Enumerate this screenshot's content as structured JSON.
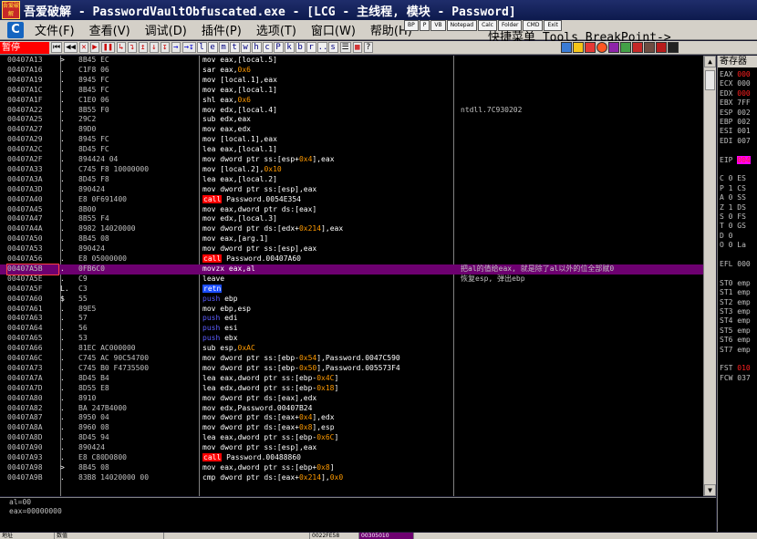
{
  "window": {
    "logo_text": "吾爱破解",
    "title": "吾爱破解 - PasswordVaultObfuscated.exe - [LCG -  主线程, 模块 - Password]"
  },
  "menu": {
    "items": [
      "文件(F)",
      "查看(V)",
      "调试(D)",
      "插件(P)",
      "选项(T)",
      "窗口(W)",
      "帮助(H)"
    ],
    "quick_tools": [
      "BP",
      "P",
      "VB",
      "Notepad",
      "Calc",
      "Folder",
      "CMD",
      "Exit"
    ],
    "extra": "快捷菜单  Tools  BreakPoint->"
  },
  "toolbar": {
    "pause_label": "暂停",
    "nav_buttons": [
      "⏮",
      "◀◀",
      "✕",
      "▶",
      "❚❚",
      "↳",
      "↴",
      "↥",
      "↓",
      "↧",
      "→",
      "→↧"
    ],
    "letter_buttons": [
      "l",
      "e",
      "m",
      "t",
      "w",
      "h",
      "c",
      "P",
      "k",
      "b",
      "r",
      "...",
      "s"
    ],
    "misc_buttons": [
      "☰",
      "▦",
      "?"
    ]
  },
  "disasm": {
    "rows": [
      {
        "addr": "00407A13",
        "mark": ">",
        "hex": "8B45 EC",
        "asm": "mov eax,[local.5]",
        "comment": ""
      },
      {
        "addr": "00407A16",
        "mark": ".",
        "hex": "C1F8 06",
        "asm": "sar eax,0x6",
        "comment": ""
      },
      {
        "addr": "00407A19",
        "mark": ".",
        "hex": "8945 FC",
        "asm": "mov [local.1],eax",
        "comment": ""
      },
      {
        "addr": "00407A1C",
        "mark": ".",
        "hex": "8B45 FC",
        "asm": "mov eax,[local.1]",
        "comment": ""
      },
      {
        "addr": "00407A1F",
        "mark": ".",
        "hex": "C1E0 06",
        "asm": "shl eax,0x6",
        "comment": ""
      },
      {
        "addr": "00407A22",
        "mark": ".",
        "hex": "8B55 F0",
        "asm": "mov edx,[local.4]",
        "comment": "ntdll.7C930202"
      },
      {
        "addr": "00407A25",
        "mark": ".",
        "hex": "29C2",
        "asm": "sub edx,eax",
        "comment": ""
      },
      {
        "addr": "00407A27",
        "mark": ".",
        "hex": "89D0",
        "asm": "mov eax,edx",
        "comment": ""
      },
      {
        "addr": "00407A29",
        "mark": ".",
        "hex": "8945 FC",
        "asm": "mov [local.1],eax",
        "comment": ""
      },
      {
        "addr": "00407A2C",
        "mark": ".",
        "hex": "8D45 FC",
        "asm": "lea eax,[local.1]",
        "comment": ""
      },
      {
        "addr": "00407A2F",
        "mark": ".",
        "hex": "894424 04",
        "asm": "mov dword ptr ss:[esp+0x4],eax",
        "comment": ""
      },
      {
        "addr": "00407A33",
        "mark": ".",
        "hex": "C745 F8 10000000",
        "asm": "mov [local.2],0x10",
        "comment": ""
      },
      {
        "addr": "00407A3A",
        "mark": ".",
        "hex": "8D45 F8",
        "asm": "lea eax,[local.2]",
        "comment": ""
      },
      {
        "addr": "00407A3D",
        "mark": ".",
        "hex": "890424",
        "asm": "mov dword ptr ss:[esp],eax",
        "comment": ""
      },
      {
        "addr": "00407A40",
        "mark": ".",
        "hex": "E8 0F691400",
        "asm": "call Password.0054E354",
        "comment": ""
      },
      {
        "addr": "00407A45",
        "mark": ".",
        "hex": "8B00",
        "asm": "mov eax,dword ptr ds:[eax]",
        "comment": ""
      },
      {
        "addr": "00407A47",
        "mark": ".",
        "hex": "8B55 F4",
        "asm": "mov edx,[local.3]",
        "comment": ""
      },
      {
        "addr": "00407A4A",
        "mark": ".",
        "hex": "8982 14020000",
        "asm": "mov dword ptr ds:[edx+0x214],eax",
        "comment": ""
      },
      {
        "addr": "00407A50",
        "mark": ".",
        "hex": "8B45 08",
        "asm": "mov eax,[arg.1]",
        "comment": ""
      },
      {
        "addr": "00407A53",
        "mark": ".",
        "hex": "890424",
        "asm": "mov dword ptr ss:[esp],eax",
        "comment": ""
      },
      {
        "addr": "00407A56",
        "mark": ".",
        "hex": "E8 05000000",
        "asm": "call Password.00407A60",
        "comment": ""
      },
      {
        "addr": "00407A5B",
        "mark": ".",
        "hex": "0FB6C0",
        "asm": "movzx eax,al",
        "comment": "把al的值给eax, 就是除了al以外的位全部赋0"
      },
      {
        "addr": "00407A5E",
        "mark": ".",
        "hex": "C9",
        "asm": "leave",
        "comment": "恢复esp, 弹出ebp"
      },
      {
        "addr": "00407A5F",
        "mark": "L.",
        "hex": "C3",
        "asm": "retn",
        "comment": ""
      },
      {
        "addr": "00407A60",
        "mark": "$",
        "hex": "55",
        "asm": "push ebp",
        "comment": ""
      },
      {
        "addr": "00407A61",
        "mark": ".",
        "hex": "89E5",
        "asm": "mov ebp,esp",
        "comment": ""
      },
      {
        "addr": "00407A63",
        "mark": ".",
        "hex": "57",
        "asm": "push edi",
        "comment": ""
      },
      {
        "addr": "00407A64",
        "mark": ".",
        "hex": "56",
        "asm": "push esi",
        "comment": ""
      },
      {
        "addr": "00407A65",
        "mark": ".",
        "hex": "53",
        "asm": "push ebx",
        "comment": ""
      },
      {
        "addr": "00407A66",
        "mark": ".",
        "hex": "81EC AC000000",
        "asm": "sub esp,0xAC",
        "comment": ""
      },
      {
        "addr": "00407A6C",
        "mark": ".",
        "hex": "C745 AC 90C54700",
        "asm": "mov dword ptr ss:[ebp-0x54],Password.0047C590",
        "comment": ""
      },
      {
        "addr": "00407A73",
        "mark": ".",
        "hex": "C745 B0 F4735500",
        "asm": "mov dword ptr ss:[ebp-0x50],Password.005573F4",
        "comment": ""
      },
      {
        "addr": "00407A7A",
        "mark": ".",
        "hex": "8D45 B4",
        "asm": "lea eax,dword ptr ss:[ebp-0x4C]",
        "comment": ""
      },
      {
        "addr": "00407A7D",
        "mark": ".",
        "hex": "8D55 E8",
        "asm": "lea edx,dword ptr ss:[ebp-0x18]",
        "comment": ""
      },
      {
        "addr": "00407A80",
        "mark": ".",
        "hex": "8910",
        "asm": "mov dword ptr ds:[eax],edx",
        "comment": ""
      },
      {
        "addr": "00407A82",
        "mark": ".",
        "hex": "BA 247B4000",
        "asm": "mov edx,Password.00407B24",
        "comment": ""
      },
      {
        "addr": "00407A87",
        "mark": ".",
        "hex": "8950 04",
        "asm": "mov dword ptr ds:[eax+0x4],edx",
        "comment": ""
      },
      {
        "addr": "00407A8A",
        "mark": ".",
        "hex": "8960 08",
        "asm": "mov dword ptr ds:[eax+0x8],esp",
        "comment": ""
      },
      {
        "addr": "00407A8D",
        "mark": ".",
        "hex": "8D45 94",
        "asm": "lea eax,dword ptr ss:[ebp-0x6C]",
        "comment": ""
      },
      {
        "addr": "00407A90",
        "mark": ".",
        "hex": "890424",
        "asm": "mov dword ptr ss:[esp],eax",
        "comment": ""
      },
      {
        "addr": "00407A93",
        "mark": ".",
        "hex": "E8 C80D0800",
        "asm": "call Password.00488860",
        "comment": ""
      },
      {
        "addr": "00407A98",
        "mark": ">",
        "hex": "8B45 08",
        "asm": "mov eax,dword ptr ss:[ebp+0x8]",
        "comment": ""
      },
      {
        "addr": "00407A9B",
        "mark": ".",
        "hex": "83B8 14020000 00",
        "asm": "cmp dword ptr ds:[eax+0x214],0x0",
        "comment": ""
      }
    ],
    "selected_index": 21
  },
  "info": {
    "lines": [
      "al=00",
      "eax=00000000"
    ]
  },
  "status": {
    "segments": [
      "地址",
      "数值",
      "",
      "0022FE58",
      "00305010"
    ]
  },
  "registers": {
    "title": "寄存器",
    "lines": [
      {
        "name": "EAX",
        "value": "000",
        "red": true
      },
      {
        "name": "ECX",
        "value": "000",
        "red": false
      },
      {
        "name": "EDX",
        "value": "000",
        "red": true
      },
      {
        "name": "EBX",
        "value": "7FF",
        "red": false
      },
      {
        "name": "ESP",
        "value": "002",
        "red": false
      },
      {
        "name": "EBP",
        "value": "002",
        "red": false
      },
      {
        "name": "ESI",
        "value": "001",
        "red": false
      },
      {
        "name": "EDI",
        "value": "007",
        "red": false
      },
      {
        "name": "",
        "value": "",
        "red": false
      },
      {
        "name": "EIP",
        "value": "004",
        "red": true
      },
      {
        "name": "",
        "value": "",
        "red": false
      },
      {
        "name": "C 0",
        "value": "ES",
        "red": false
      },
      {
        "name": "P 1",
        "value": "CS",
        "red": false
      },
      {
        "name": "A 0",
        "value": "SS",
        "red": false
      },
      {
        "name": "Z 1",
        "value": "DS",
        "red": false
      },
      {
        "name": "S 0",
        "value": "FS",
        "red": false
      },
      {
        "name": "T 0",
        "value": "GS",
        "red": false
      },
      {
        "name": "D 0",
        "value": "",
        "red": false
      },
      {
        "name": "O 0",
        "value": "La",
        "red": false
      },
      {
        "name": "",
        "value": "",
        "red": false
      },
      {
        "name": "EFL",
        "value": "000",
        "red": false
      },
      {
        "name": "",
        "value": "",
        "red": false
      },
      {
        "name": "ST0",
        "value": "emp",
        "red": false
      },
      {
        "name": "ST1",
        "value": "emp",
        "red": false
      },
      {
        "name": "ST2",
        "value": "emp",
        "red": false
      },
      {
        "name": "ST3",
        "value": "emp",
        "red": false
      },
      {
        "name": "ST4",
        "value": "emp",
        "red": false
      },
      {
        "name": "ST5",
        "value": "emp",
        "red": false
      },
      {
        "name": "ST6",
        "value": "emp",
        "red": false
      },
      {
        "name": "ST7",
        "value": "emp",
        "red": false
      },
      {
        "name": "",
        "value": "",
        "red": false
      },
      {
        "name": "FST",
        "value": "010",
        "red": true
      },
      {
        "name": "FCW",
        "value": "037",
        "red": false
      }
    ]
  },
  "colors": {
    "selected_row": "#6d0070",
    "call_bg": "#ff0000",
    "retn_bg": "#1a4dff",
    "push_fg": "#5c5cff",
    "title_bar": "#1f2d6b"
  }
}
